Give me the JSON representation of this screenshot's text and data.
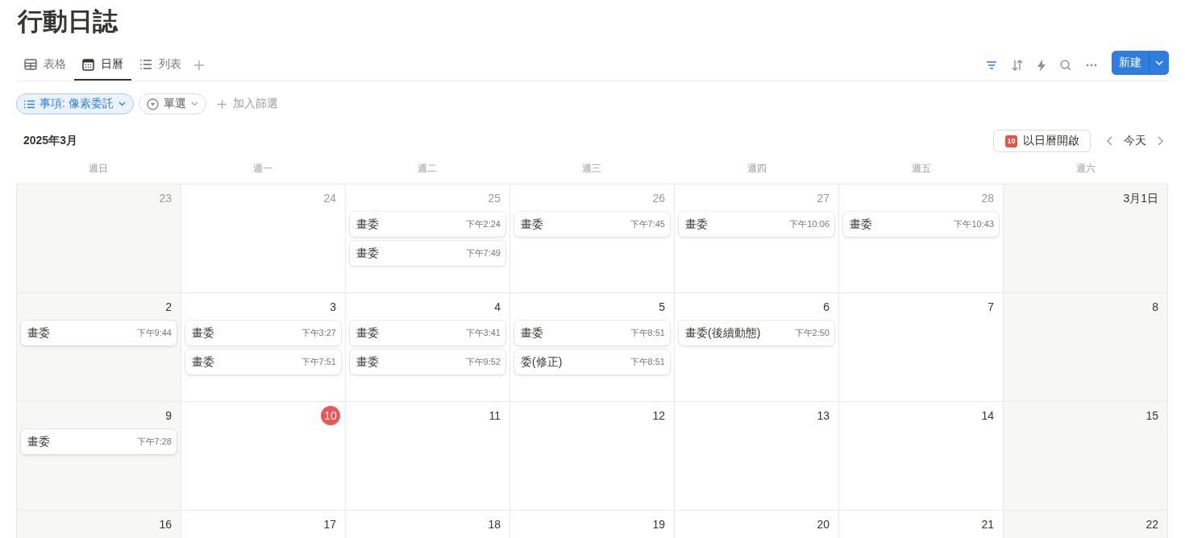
{
  "title": "行動日誌",
  "tabs": [
    {
      "label": "表格",
      "kind": "table",
      "selected": false
    },
    {
      "label": "日曆",
      "kind": "calendar",
      "selected": true
    },
    {
      "label": "列表",
      "kind": "list",
      "selected": false
    }
  ],
  "toolbar": [
    {
      "kind": "filter",
      "active": true
    },
    {
      "kind": "sort",
      "active": false
    },
    {
      "kind": "automation",
      "active": false
    },
    {
      "kind": "search",
      "active": false
    },
    {
      "kind": "more",
      "active": false
    }
  ],
  "new_button": {
    "label": "新建"
  },
  "filters": [
    {
      "label": "事項: 像素委託",
      "kind": "property",
      "active": true
    },
    {
      "label": "單選",
      "kind": "select",
      "active": false
    }
  ],
  "add_filter": {
    "label": "加入篩選"
  },
  "month": "2025年3月",
  "open_calendar": {
    "label": "以日曆開啟",
    "icon_day": "10"
  },
  "today_button": {
    "label": "今天"
  },
  "weekdays": [
    "週日",
    "週一",
    "週二",
    "週三",
    "週四",
    "週五",
    "週六"
  ],
  "weeks": [
    {
      "days": [
        {
          "date": "23",
          "in_month": false,
          "today": false
        },
        {
          "date": "24",
          "in_month": false,
          "today": false
        },
        {
          "date": "25",
          "in_month": false,
          "today": false,
          "events": [
            {
              "title": "畫委",
              "time": "下午2:24"
            },
            {
              "title": "畫委",
              "time": "下午7:49"
            }
          ]
        },
        {
          "date": "26",
          "in_month": false,
          "today": false,
          "events": [
            {
              "title": "畫委",
              "time": "下午7:45"
            }
          ]
        },
        {
          "date": "27",
          "in_month": false,
          "today": false,
          "events": [
            {
              "title": "畫委",
              "time": "下午10:06"
            }
          ]
        },
        {
          "date": "28",
          "in_month": false,
          "today": false,
          "events": [
            {
              "title": "畫委",
              "time": "下午10:43"
            }
          ]
        },
        {
          "date": "3月1日",
          "in_month": true,
          "today": false
        }
      ]
    },
    {
      "days": [
        {
          "date": "2",
          "in_month": true,
          "today": false,
          "events": [
            {
              "title": "畫委",
              "time": "下午9:44"
            }
          ]
        },
        {
          "date": "3",
          "in_month": true,
          "today": false,
          "events": [
            {
              "title": "畫委",
              "time": "下午3:27"
            },
            {
              "title": "畫委",
              "time": "下午7:51"
            }
          ]
        },
        {
          "date": "4",
          "in_month": true,
          "today": false,
          "events": [
            {
              "title": "畫委",
              "time": "下午3:41"
            },
            {
              "title": "畫委",
              "time": "下午9:52"
            }
          ]
        },
        {
          "date": "5",
          "in_month": true,
          "today": false,
          "events": [
            {
              "title": "畫委",
              "time": "下午8:51"
            },
            {
              "title": "委(修正)",
              "time": "下午8:51"
            }
          ]
        },
        {
          "date": "6",
          "in_month": true,
          "today": false,
          "events": [
            {
              "title": "畫委(後續動態)",
              "time": "下午2:50"
            }
          ]
        },
        {
          "date": "7",
          "in_month": true,
          "today": false
        },
        {
          "date": "8",
          "in_month": true,
          "today": false
        }
      ]
    },
    {
      "days": [
        {
          "date": "9",
          "in_month": true,
          "today": false,
          "events": [
            {
              "title": "畫委",
              "time": "下午7:28"
            }
          ]
        },
        {
          "date": "10",
          "in_month": true,
          "today": true
        },
        {
          "date": "11",
          "in_month": true,
          "today": false
        },
        {
          "date": "12",
          "in_month": true,
          "today": false
        },
        {
          "date": "13",
          "in_month": true,
          "today": false
        },
        {
          "date": "14",
          "in_month": true,
          "today": false
        },
        {
          "date": "15",
          "in_month": true,
          "today": false
        }
      ]
    },
    {
      "days": [
        {
          "date": "16",
          "in_month": true,
          "today": false
        },
        {
          "date": "17",
          "in_month": true,
          "today": false
        },
        {
          "date": "18",
          "in_month": true,
          "today": false
        },
        {
          "date": "19",
          "in_month": true,
          "today": false
        },
        {
          "date": "20",
          "in_month": true,
          "today": false
        },
        {
          "date": "21",
          "in_month": true,
          "today": false
        },
        {
          "date": "22",
          "in_month": true,
          "today": false
        }
      ]
    }
  ]
}
